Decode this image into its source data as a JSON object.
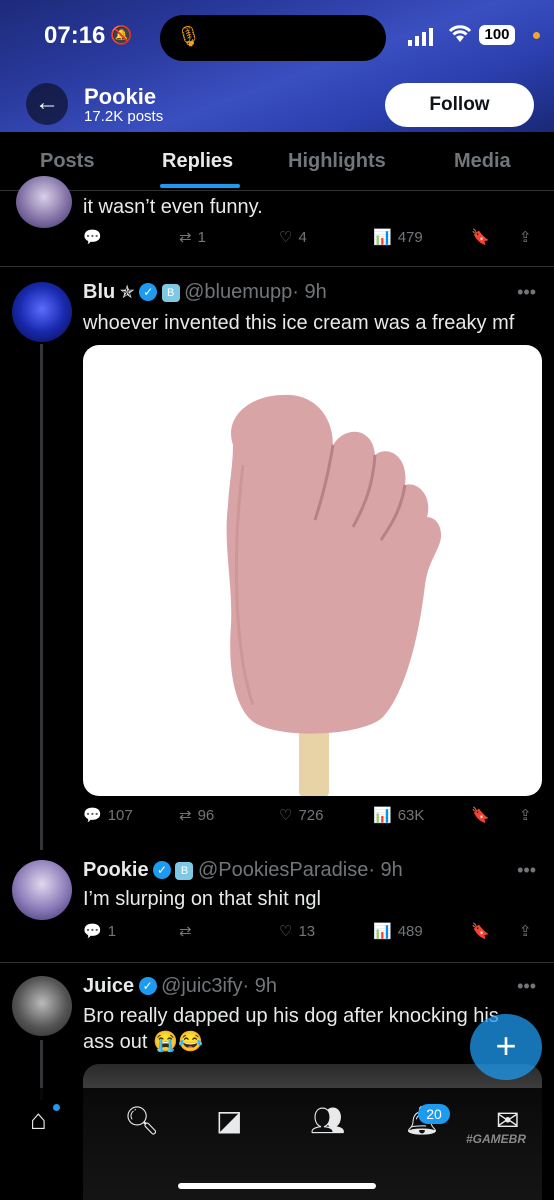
{
  "status_bar": {
    "time": "07:16",
    "battery": "100"
  },
  "header": {
    "title": "Pookie",
    "subtitle": "17.2K posts",
    "follow_label": "Follow"
  },
  "tabs": [
    {
      "label": "Posts"
    },
    {
      "label": "Replies"
    },
    {
      "label": "Highlights"
    },
    {
      "label": "Media"
    }
  ],
  "tweets": [
    {
      "text": "it wasn’t even funny.",
      "replies": "",
      "reposts": "1",
      "likes": "4",
      "views": "479"
    },
    {
      "name": "Blu",
      "name_suffix": "✯",
      "handle": "@bluemupp",
      "time": "· 9h",
      "text": "whoever invented this ice cream was a freaky mf",
      "replies": "107",
      "reposts": "96",
      "likes": "726",
      "views": "63K"
    },
    {
      "name": "Pookie",
      "handle": "@PookiesParadise",
      "time": "· 9h",
      "text": "I’m slurping on that shit ngl",
      "replies": "1",
      "reposts": "",
      "likes": "13",
      "views": "489"
    },
    {
      "name": "Juice",
      "handle": "@juic3ify",
      "time": "· 9h",
      "text": "Bro really dapped up his dog after knocking his ass out 😭😂"
    }
  ],
  "bottom_nav": {
    "notifications_count": "20",
    "watermark": "#GAMEBR"
  },
  "colors": {
    "accent": "#1d9bf0",
    "background": "#000000",
    "header_gradient": "#2a3a9e"
  }
}
